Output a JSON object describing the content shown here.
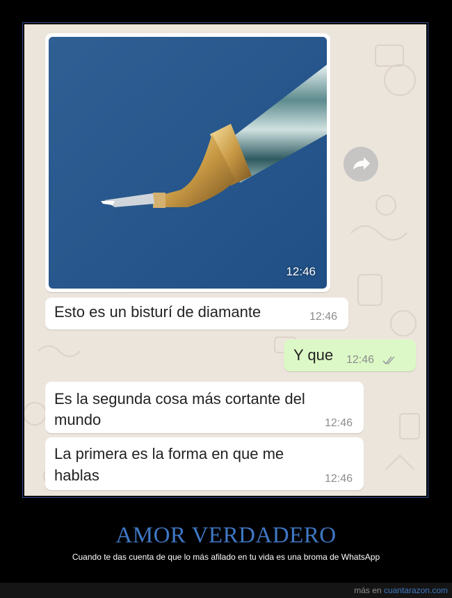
{
  "chat": {
    "image_message": {
      "time": "12:46",
      "icon": "forward-icon"
    },
    "messages": [
      {
        "text": "Esto es un bisturí de diamante",
        "time": "12:46",
        "direction": "in"
      },
      {
        "text": "Y que",
        "time": "12:46",
        "direction": "out",
        "status_icon": "double-check-icon"
      },
      {
        "line1": "Es la segunda cosa más cortante del",
        "line2": "mundo",
        "time": "12:46",
        "direction": "in"
      },
      {
        "line1": "La primera es la forma en que me",
        "line2": "hablas",
        "time": "12:46",
        "direction": "in"
      }
    ]
  },
  "poster": {
    "title": "AMOR VERDADERO",
    "subtitle": "Cuando te das cuenta de que lo más afilado en tu vida es una broma de WhatsApp"
  },
  "footer": {
    "prefix": "más en ",
    "site": "cuantarazon.com"
  },
  "colors": {
    "title": "#3f78c4",
    "incoming_bubble": "#ffffff",
    "outgoing_bubble": "#dcf8c6",
    "chat_background": "#ece5dc"
  }
}
